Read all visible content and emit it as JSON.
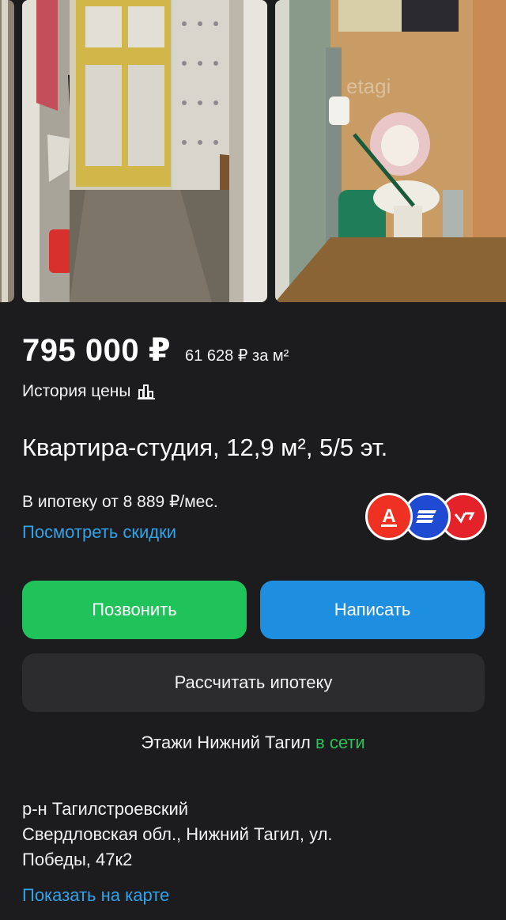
{
  "listing": {
    "price": "795 000 ₽",
    "price_per_sqm": "61 628 ₽ за м²",
    "price_history_label": "История цены",
    "title": "Квартира-студия, 12,9 м², 5/5 эт.",
    "mortgage_text": "В ипотеку от 8 889 ₽/мес.",
    "discounts_link": "Посмотреть скидки"
  },
  "gallery": {
    "watermark": "etagi"
  },
  "banks": [
    {
      "icon": "alfa-bank-logo",
      "glyph": "А",
      "color": "#ef3124"
    },
    {
      "icon": "bank-logo-stripes",
      "color": "#1e4bd2"
    },
    {
      "icon": "bank-logo-check",
      "color": "#e42229"
    }
  ],
  "actions": {
    "call_label": "Позвонить",
    "write_label": "Написать",
    "mortgage_calc_label": "Рассчитать ипотеку"
  },
  "agency": {
    "name": "Этажи Нижний Тагил",
    "status": "в сети"
  },
  "address": {
    "district": "р-н Тагилстроевский",
    "line1": "Свердловская обл., Нижний Тагил, ул.",
    "line2": "Победы, 47к2",
    "map_link": "Показать на карте"
  },
  "colors": {
    "background": "#1c1c1e",
    "call": "#1fc35a",
    "write": "#1e8fe0",
    "link": "#2fa3ea",
    "online": "#27c35c"
  }
}
